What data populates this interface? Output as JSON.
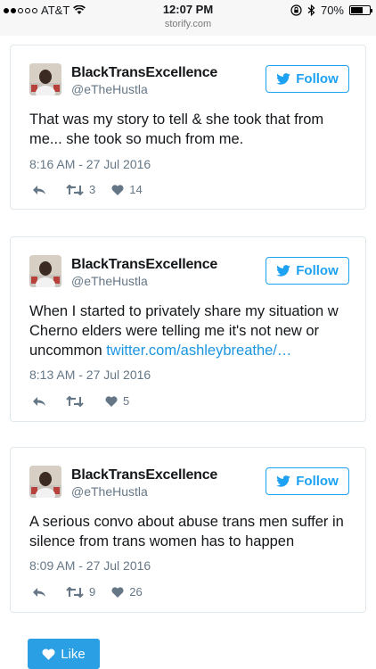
{
  "status_bar": {
    "carrier": "AT&T",
    "time": "12:07 PM",
    "url": "storify.com",
    "battery": "70%",
    "battery_level": 0.7
  },
  "tweets": [
    {
      "name": "BlackTransExcellence",
      "handle": "@eTheHustla",
      "follow_label": "Follow",
      "text": "That was my story to tell & she took that from me... she took so much from me.",
      "link": "",
      "timestamp": "8:16 AM - 27 Jul 2016",
      "retweets": "3",
      "likes": "14"
    },
    {
      "name": "BlackTransExcellence",
      "handle": "@eTheHustla",
      "follow_label": "Follow",
      "text": "When I started to privately share my situation w Cherno elders were telling me it's not new or uncommon ",
      "link": "twitter.com/ashleybreathe/…",
      "timestamp": "8:13 AM - 27 Jul 2016",
      "retweets": "",
      "likes": "5"
    },
    {
      "name": "BlackTransExcellence",
      "handle": "@eTheHustla",
      "follow_label": "Follow",
      "text": "A serious convo about abuse trans men suffer in silence from trans women has to happen",
      "link": "",
      "timestamp": "8:09 AM - 27 Jul 2016",
      "retweets": "9",
      "likes": "26"
    }
  ],
  "like_button": {
    "label": "Like"
  },
  "icons": {
    "reply": "reply-icon",
    "retweet": "retweet-icon",
    "like": "heart-icon",
    "follow": "twitter-bird-icon"
  },
  "colors": {
    "twitter_blue": "#1da1f2",
    "link_blue": "#1b95e0",
    "like_button": "#2a9fe3",
    "muted": "#657786"
  }
}
